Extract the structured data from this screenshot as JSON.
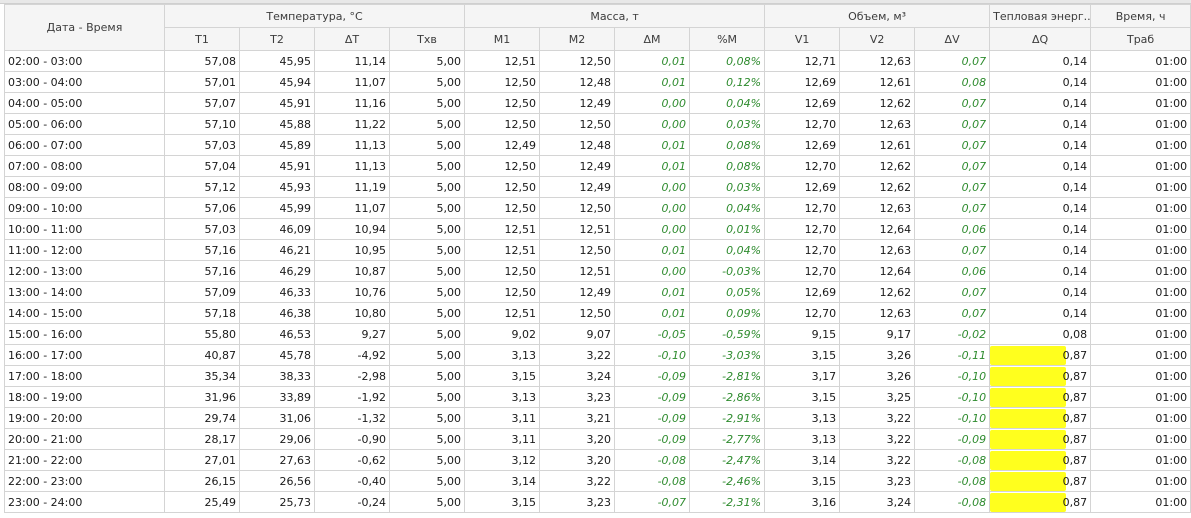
{
  "headers": {
    "datetime": "Дата - Время",
    "temp_group": "Температура, °С",
    "mass_group": "Масса, т",
    "volume_group": "Объем, м³",
    "heat_group": "Тепловая энерг...",
    "time_group": "Время, ч",
    "t1": "T1",
    "t2": "T2",
    "dt": "ΔT",
    "txv": "Tхв",
    "m1": "M1",
    "m2": "M2",
    "dm": "ΔM",
    "pm": "%M",
    "v1": "V1",
    "v2": "V2",
    "dv": "ΔV",
    "dq": "ΔQ",
    "trab": "Tраб"
  },
  "highlight_color": "#ffff1e",
  "rows": [
    {
      "time": "02:00 - 03:00",
      "t1": "57,08",
      "t2": "45,95",
      "dt": "11,14",
      "txv": "5,00",
      "m1": "12,51",
      "m2": "12,50",
      "dm": "0,01",
      "pm": "0,08%",
      "v1": "12,71",
      "v2": "12,63",
      "dv": "0,07",
      "dq": "0,14",
      "trab": "01:00",
      "hl": false
    },
    {
      "time": "03:00 - 04:00",
      "t1": "57,01",
      "t2": "45,94",
      "dt": "11,07",
      "txv": "5,00",
      "m1": "12,50",
      "m2": "12,48",
      "dm": "0,01",
      "pm": "0,12%",
      "v1": "12,69",
      "v2": "12,61",
      "dv": "0,08",
      "dq": "0,14",
      "trab": "01:00",
      "hl": false
    },
    {
      "time": "04:00 - 05:00",
      "t1": "57,07",
      "t2": "45,91",
      "dt": "11,16",
      "txv": "5,00",
      "m1": "12,50",
      "m2": "12,49",
      "dm": "0,00",
      "pm": "0,04%",
      "v1": "12,69",
      "v2": "12,62",
      "dv": "0,07",
      "dq": "0,14",
      "trab": "01:00",
      "hl": false
    },
    {
      "time": "05:00 - 06:00",
      "t1": "57,10",
      "t2": "45,88",
      "dt": "11,22",
      "txv": "5,00",
      "m1": "12,50",
      "m2": "12,50",
      "dm": "0,00",
      "pm": "0,03%",
      "v1": "12,70",
      "v2": "12,63",
      "dv": "0,07",
      "dq": "0,14",
      "trab": "01:00",
      "hl": false
    },
    {
      "time": "06:00 - 07:00",
      "t1": "57,03",
      "t2": "45,89",
      "dt": "11,13",
      "txv": "5,00",
      "m1": "12,49",
      "m2": "12,48",
      "dm": "0,01",
      "pm": "0,08%",
      "v1": "12,69",
      "v2": "12,61",
      "dv": "0,07",
      "dq": "0,14",
      "trab": "01:00",
      "hl": false
    },
    {
      "time": "07:00 - 08:00",
      "t1": "57,04",
      "t2": "45,91",
      "dt": "11,13",
      "txv": "5,00",
      "m1": "12,50",
      "m2": "12,49",
      "dm": "0,01",
      "pm": "0,08%",
      "v1": "12,70",
      "v2": "12,62",
      "dv": "0,07",
      "dq": "0,14",
      "trab": "01:00",
      "hl": false
    },
    {
      "time": "08:00 - 09:00",
      "t1": "57,12",
      "t2": "45,93",
      "dt": "11,19",
      "txv": "5,00",
      "m1": "12,50",
      "m2": "12,49",
      "dm": "0,00",
      "pm": "0,03%",
      "v1": "12,69",
      "v2": "12,62",
      "dv": "0,07",
      "dq": "0,14",
      "trab": "01:00",
      "hl": false
    },
    {
      "time": "09:00 - 10:00",
      "t1": "57,06",
      "t2": "45,99",
      "dt": "11,07",
      "txv": "5,00",
      "m1": "12,50",
      "m2": "12,50",
      "dm": "0,00",
      "pm": "0,04%",
      "v1": "12,70",
      "v2": "12,63",
      "dv": "0,07",
      "dq": "0,14",
      "trab": "01:00",
      "hl": false
    },
    {
      "time": "10:00 - 11:00",
      "t1": "57,03",
      "t2": "46,09",
      "dt": "10,94",
      "txv": "5,00",
      "m1": "12,51",
      "m2": "12,51",
      "dm": "0,00",
      "pm": "0,01%",
      "v1": "12,70",
      "v2": "12,64",
      "dv": "0,06",
      "dq": "0,14",
      "trab": "01:00",
      "hl": false
    },
    {
      "time": "11:00 - 12:00",
      "t1": "57,16",
      "t2": "46,21",
      "dt": "10,95",
      "txv": "5,00",
      "m1": "12,51",
      "m2": "12,50",
      "dm": "0,01",
      "pm": "0,04%",
      "v1": "12,70",
      "v2": "12,63",
      "dv": "0,07",
      "dq": "0,14",
      "trab": "01:00",
      "hl": false
    },
    {
      "time": "12:00 - 13:00",
      "t1": "57,16",
      "t2": "46,29",
      "dt": "10,87",
      "txv": "5,00",
      "m1": "12,50",
      "m2": "12,51",
      "dm": "0,00",
      "pm": "-0,03%",
      "v1": "12,70",
      "v2": "12,64",
      "dv": "0,06",
      "dq": "0,14",
      "trab": "01:00",
      "hl": false
    },
    {
      "time": "13:00 - 14:00",
      "t1": "57,09",
      "t2": "46,33",
      "dt": "10,76",
      "txv": "5,00",
      "m1": "12,50",
      "m2": "12,49",
      "dm": "0,01",
      "pm": "0,05%",
      "v1": "12,69",
      "v2": "12,62",
      "dv": "0,07",
      "dq": "0,14",
      "trab": "01:00",
      "hl": false
    },
    {
      "time": "14:00 - 15:00",
      "t1": "57,18",
      "t2": "46,38",
      "dt": "10,80",
      "txv": "5,00",
      "m1": "12,51",
      "m2": "12,50",
      "dm": "0,01",
      "pm": "0,09%",
      "v1": "12,70",
      "v2": "12,63",
      "dv": "0,07",
      "dq": "0,14",
      "trab": "01:00",
      "hl": false
    },
    {
      "time": "15:00 - 16:00",
      "t1": "55,80",
      "t2": "46,53",
      "dt": "9,27",
      "txv": "5,00",
      "m1": "9,02",
      "m2": "9,07",
      "dm": "-0,05",
      "pm": "-0,59%",
      "v1": "9,15",
      "v2": "9,17",
      "dv": "-0,02",
      "dq": "0,08",
      "trab": "01:00",
      "hl": false
    },
    {
      "time": "16:00 - 17:00",
      "t1": "40,87",
      "t2": "45,78",
      "dt": "-4,92",
      "txv": "5,00",
      "m1": "3,13",
      "m2": "3,22",
      "dm": "-0,10",
      "pm": "-3,03%",
      "v1": "3,15",
      "v2": "3,26",
      "dv": "-0,11",
      "dq": "0,87",
      "trab": "01:00",
      "hl": true
    },
    {
      "time": "17:00 - 18:00",
      "t1": "35,34",
      "t2": "38,33",
      "dt": "-2,98",
      "txv": "5,00",
      "m1": "3,15",
      "m2": "3,24",
      "dm": "-0,09",
      "pm": "-2,81%",
      "v1": "3,17",
      "v2": "3,26",
      "dv": "-0,10",
      "dq": "0,87",
      "trab": "01:00",
      "hl": true
    },
    {
      "time": "18:00 - 19:00",
      "t1": "31,96",
      "t2": "33,89",
      "dt": "-1,92",
      "txv": "5,00",
      "m1": "3,13",
      "m2": "3,23",
      "dm": "-0,09",
      "pm": "-2,86%",
      "v1": "3,15",
      "v2": "3,25",
      "dv": "-0,10",
      "dq": "0,87",
      "trab": "01:00",
      "hl": true
    },
    {
      "time": "19:00 - 20:00",
      "t1": "29,74",
      "t2": "31,06",
      "dt": "-1,32",
      "txv": "5,00",
      "m1": "3,11",
      "m2": "3,21",
      "dm": "-0,09",
      "pm": "-2,91%",
      "v1": "3,13",
      "v2": "3,22",
      "dv": "-0,10",
      "dq": "0,87",
      "trab": "01:00",
      "hl": true
    },
    {
      "time": "20:00 - 21:00",
      "t1": "28,17",
      "t2": "29,06",
      "dt": "-0,90",
      "txv": "5,00",
      "m1": "3,11",
      "m2": "3,20",
      "dm": "-0,09",
      "pm": "-2,77%",
      "v1": "3,13",
      "v2": "3,22",
      "dv": "-0,09",
      "dq": "0,87",
      "trab": "01:00",
      "hl": true
    },
    {
      "time": "21:00 - 22:00",
      "t1": "27,01",
      "t2": "27,63",
      "dt": "-0,62",
      "txv": "5,00",
      "m1": "3,12",
      "m2": "3,20",
      "dm": "-0,08",
      "pm": "-2,47%",
      "v1": "3,14",
      "v2": "3,22",
      "dv": "-0,08",
      "dq": "0,87",
      "trab": "01:00",
      "hl": true
    },
    {
      "time": "22:00 - 23:00",
      "t1": "26,15",
      "t2": "26,56",
      "dt": "-0,40",
      "txv": "5,00",
      "m1": "3,14",
      "m2": "3,22",
      "dm": "-0,08",
      "pm": "-2,46%",
      "v1": "3,15",
      "v2": "3,23",
      "dv": "-0,08",
      "dq": "0,87",
      "trab": "01:00",
      "hl": true
    },
    {
      "time": "23:00 - 24:00",
      "t1": "25,49",
      "t2": "25,73",
      "dt": "-0,24",
      "txv": "5,00",
      "m1": "3,15",
      "m2": "3,23",
      "dm": "-0,07",
      "pm": "-2,31%",
      "v1": "3,16",
      "v2": "3,24",
      "dv": "-0,08",
      "dq": "0,87",
      "trab": "01:00",
      "hl": true
    }
  ]
}
